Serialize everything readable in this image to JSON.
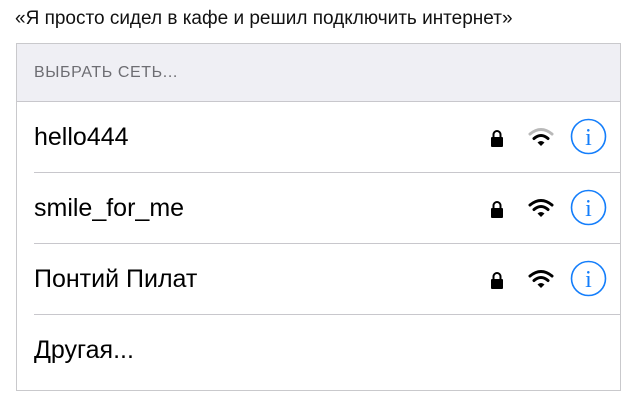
{
  "caption": "«Я просто сидел в кафе и решил подключить интернет»",
  "section_header": "ВЫБРАТЬ СЕТЬ...",
  "networks": [
    {
      "name": "hello444",
      "secured": true,
      "signal": "medium",
      "icons": [
        "lock-icon",
        "wifi-icon",
        "info-icon"
      ]
    },
    {
      "name": "smile_for_me",
      "secured": true,
      "signal": "full",
      "icons": [
        "lock-icon",
        "wifi-icon",
        "info-icon"
      ]
    },
    {
      "name": "Понтий Пилат",
      "secured": true,
      "signal": "full",
      "icons": [
        "lock-icon",
        "wifi-icon",
        "info-icon"
      ]
    }
  ],
  "other_label": "Другая...",
  "colors": {
    "accent": "#147efb",
    "header_bg": "#efeff4",
    "header_text": "#6d6d72",
    "separator": "#c8c7cc",
    "wifi_active": "#000000",
    "wifi_inactive": "#b9b9b9"
  }
}
